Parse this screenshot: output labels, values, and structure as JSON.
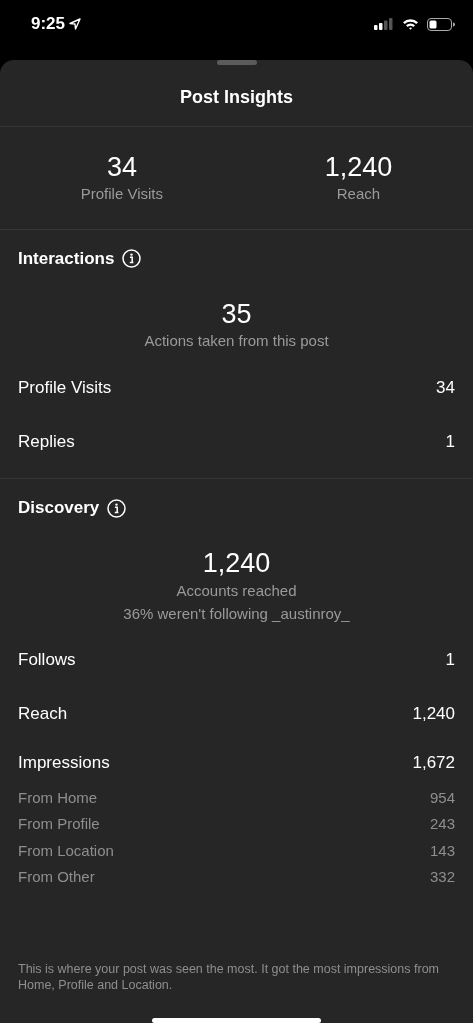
{
  "status_bar": {
    "time": "9:25"
  },
  "sheet": {
    "title": "Post Insights"
  },
  "summary": [
    {
      "value": "34",
      "label": "Profile Visits"
    },
    {
      "value": "1,240",
      "label": "Reach"
    }
  ],
  "sections": [
    {
      "title": "Interactions",
      "big_value": "35",
      "captions": [
        "Actions taken from this post"
      ],
      "rows": [
        {
          "kind": "main",
          "label": "Profile Visits",
          "value": "34"
        },
        {
          "kind": "main",
          "label": "Replies",
          "value": "1"
        }
      ]
    },
    {
      "title": "Discovery",
      "big_value": "1,240",
      "captions": [
        "Accounts reached",
        "36% weren't following _austinroy_"
      ],
      "rows": [
        {
          "kind": "main",
          "label": "Follows",
          "value": "1"
        },
        {
          "kind": "main",
          "label": "Reach",
          "value": "1,240"
        },
        {
          "kind": "main",
          "label": "Impressions",
          "value": "1,672"
        },
        {
          "kind": "sub",
          "label": "From Home",
          "value": "954"
        },
        {
          "kind": "sub",
          "label": "From Profile",
          "value": "243"
        },
        {
          "kind": "sub",
          "label": "From Location",
          "value": "143"
        },
        {
          "kind": "sub",
          "label": "From Other",
          "value": "332"
        }
      ]
    }
  ],
  "footnote": "This is where your post was seen the most. It got the most impressions from Home, Profile and Location."
}
